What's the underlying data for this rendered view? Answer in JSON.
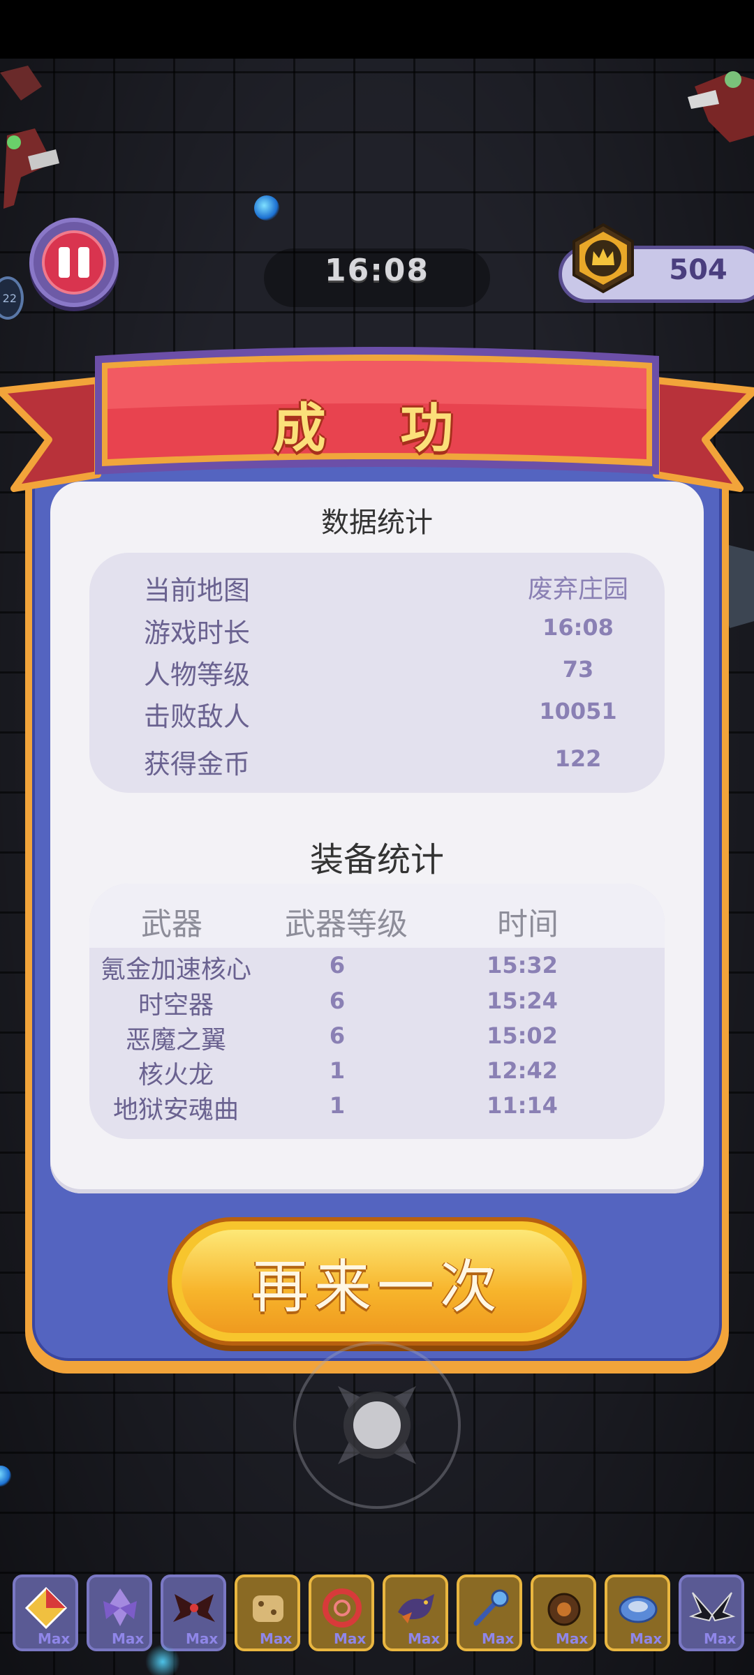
{
  "hud": {
    "timer": "16:08",
    "coins": "504",
    "level_badge": "22"
  },
  "result": {
    "title": "成 功",
    "stats_title": "数据统计",
    "stats": [
      {
        "label": "当前地图",
        "value": "废弃庄园"
      },
      {
        "label": "游戏时长",
        "value": "16:08"
      },
      {
        "label": "人物等级",
        "value": "73"
      },
      {
        "label": "击败敌人",
        "value": "10051"
      },
      {
        "label": "获得金币",
        "value": "122"
      }
    ],
    "equip_title": "装备统计",
    "equip_headers": {
      "weapon": "武器",
      "level": "武器等级",
      "time": "时间"
    },
    "equipment": [
      {
        "name": "氪金加速核心",
        "level": "6",
        "time": "15:32"
      },
      {
        "name": "时空器",
        "level": "6",
        "time": "15:24"
      },
      {
        "name": "恶魔之翼",
        "level": "6",
        "time": "15:02"
      },
      {
        "name": "核火龙",
        "level": "1",
        "time": "12:42"
      },
      {
        "name": "地狱安魂曲",
        "level": "1",
        "time": "11:14"
      }
    ],
    "retry_label": "再来一次"
  },
  "slots": [
    {
      "icon": "diamond-icon",
      "badge": "Max",
      "frame": "purple"
    },
    {
      "icon": "crystal-flower-icon",
      "badge": "Max",
      "frame": "purple"
    },
    {
      "icon": "demon-wings-icon",
      "badge": "Max",
      "frame": "purple"
    },
    {
      "icon": "cookie-icon",
      "badge": "Max",
      "frame": "gold"
    },
    {
      "icon": "red-ring-icon",
      "badge": "Max",
      "frame": "gold"
    },
    {
      "icon": "dragon-icon",
      "badge": "Max",
      "frame": "gold"
    },
    {
      "icon": "magic-wand-icon",
      "badge": "Max",
      "frame": "gold"
    },
    {
      "icon": "bomb-icon",
      "badge": "Max",
      "frame": "gold"
    },
    {
      "icon": "cannon-icon",
      "badge": "Max",
      "frame": "gold"
    },
    {
      "icon": "spiky-wings-icon",
      "badge": "Max",
      "frame": "purple"
    }
  ]
}
